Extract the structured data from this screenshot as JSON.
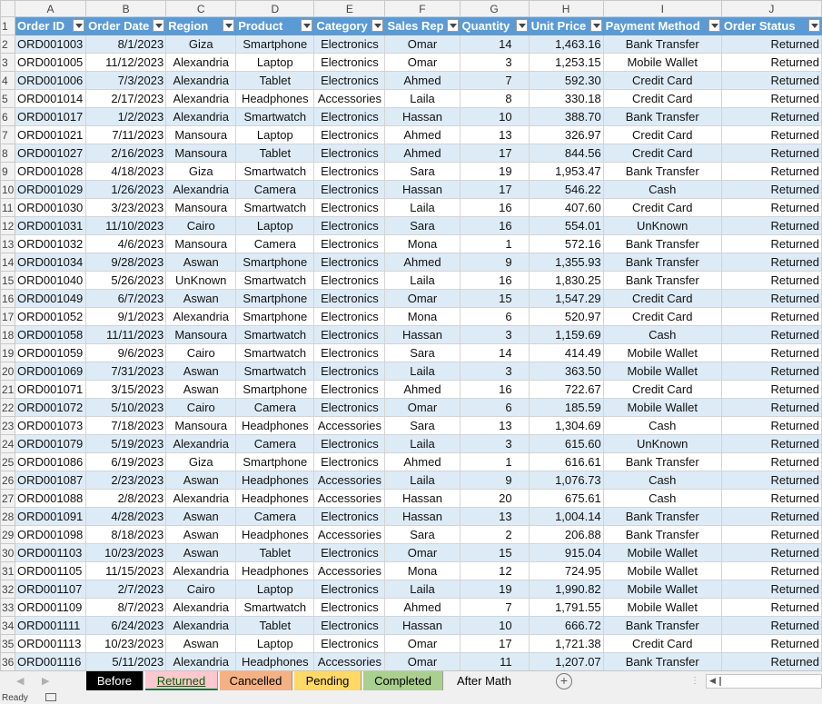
{
  "columns": [
    "A",
    "B",
    "C",
    "D",
    "E",
    "F",
    "G",
    "H",
    "I",
    "J"
  ],
  "headers": [
    "Order ID",
    "Order Date",
    "Region",
    "Product",
    "Category",
    "Sales Rep",
    "Quantity",
    "Unit Price",
    "Payment Method",
    "Order Status"
  ],
  "rows": [
    [
      "ORD001003",
      "8/1/2023",
      "Giza",
      "Smartphone",
      "Electronics",
      "Omar",
      "14",
      "1,463.16",
      "Bank Transfer",
      "Returned"
    ],
    [
      "ORD001005",
      "11/12/2023",
      "Alexandria",
      "Laptop",
      "Electronics",
      "Omar",
      "3",
      "1,253.15",
      "Mobile Wallet",
      "Returned"
    ],
    [
      "ORD001006",
      "7/3/2023",
      "Alexandria",
      "Tablet",
      "Electronics",
      "Ahmed",
      "7",
      "592.30",
      "Credit Card",
      "Returned"
    ],
    [
      "ORD001014",
      "2/17/2023",
      "Alexandria",
      "Headphones",
      "Accessories",
      "Laila",
      "8",
      "330.18",
      "Credit Card",
      "Returned"
    ],
    [
      "ORD001017",
      "1/2/2023",
      "Alexandria",
      "Smartwatch",
      "Electronics",
      "Hassan",
      "10",
      "388.70",
      "Bank Transfer",
      "Returned"
    ],
    [
      "ORD001021",
      "7/11/2023",
      "Mansoura",
      "Laptop",
      "Electronics",
      "Ahmed",
      "13",
      "326.97",
      "Credit Card",
      "Returned"
    ],
    [
      "ORD001027",
      "2/16/2023",
      "Mansoura",
      "Tablet",
      "Electronics",
      "Ahmed",
      "17",
      "844.56",
      "Credit Card",
      "Returned"
    ],
    [
      "ORD001028",
      "4/18/2023",
      "Giza",
      "Smartwatch",
      "Electronics",
      "Sara",
      "19",
      "1,953.47",
      "Bank Transfer",
      "Returned"
    ],
    [
      "ORD001029",
      "1/26/2023",
      "Alexandria",
      "Camera",
      "Electronics",
      "Hassan",
      "17",
      "546.22",
      "Cash",
      "Returned"
    ],
    [
      "ORD001030",
      "3/23/2023",
      "Mansoura",
      "Smartwatch",
      "Electronics",
      "Laila",
      "16",
      "407.60",
      "Credit Card",
      "Returned"
    ],
    [
      "ORD001031",
      "11/10/2023",
      "Cairo",
      "Laptop",
      "Electronics",
      "Sara",
      "16",
      "554.01",
      "UnKnown",
      "Returned"
    ],
    [
      "ORD001032",
      "4/6/2023",
      "Mansoura",
      "Camera",
      "Electronics",
      "Mona",
      "1",
      "572.16",
      "Bank Transfer",
      "Returned"
    ],
    [
      "ORD001034",
      "9/28/2023",
      "Aswan",
      "Smartphone",
      "Electronics",
      "Ahmed",
      "9",
      "1,355.93",
      "Bank Transfer",
      "Returned"
    ],
    [
      "ORD001040",
      "5/26/2023",
      "UnKnown",
      "Smartwatch",
      "Electronics",
      "Laila",
      "16",
      "1,830.25",
      "Bank Transfer",
      "Returned"
    ],
    [
      "ORD001049",
      "6/7/2023",
      "Aswan",
      "Smartphone",
      "Electronics",
      "Omar",
      "15",
      "1,547.29",
      "Credit Card",
      "Returned"
    ],
    [
      "ORD001052",
      "9/1/2023",
      "Alexandria",
      "Smartphone",
      "Electronics",
      "Mona",
      "6",
      "520.97",
      "Credit Card",
      "Returned"
    ],
    [
      "ORD001058",
      "11/11/2023",
      "Mansoura",
      "Smartwatch",
      "Electronics",
      "Hassan",
      "3",
      "1,159.69",
      "Cash",
      "Returned"
    ],
    [
      "ORD001059",
      "9/6/2023",
      "Cairo",
      "Smartwatch",
      "Electronics",
      "Sara",
      "14",
      "414.49",
      "Mobile Wallet",
      "Returned"
    ],
    [
      "ORD001069",
      "7/31/2023",
      "Aswan",
      "Smartwatch",
      "Electronics",
      "Laila",
      "3",
      "363.50",
      "Mobile Wallet",
      "Returned"
    ],
    [
      "ORD001071",
      "3/15/2023",
      "Aswan",
      "Smartphone",
      "Electronics",
      "Ahmed",
      "16",
      "722.67",
      "Credit Card",
      "Returned"
    ],
    [
      "ORD001072",
      "5/10/2023",
      "Cairo",
      "Camera",
      "Electronics",
      "Omar",
      "6",
      "185.59",
      "Mobile Wallet",
      "Returned"
    ],
    [
      "ORD001073",
      "7/18/2023",
      "Mansoura",
      "Headphones",
      "Accessories",
      "Sara",
      "13",
      "1,304.69",
      "Cash",
      "Returned"
    ],
    [
      "ORD001079",
      "5/19/2023",
      "Alexandria",
      "Camera",
      "Electronics",
      "Laila",
      "3",
      "615.60",
      "UnKnown",
      "Returned"
    ],
    [
      "ORD001086",
      "6/19/2023",
      "Giza",
      "Smartphone",
      "Electronics",
      "Ahmed",
      "1",
      "616.61",
      "Bank Transfer",
      "Returned"
    ],
    [
      "ORD001087",
      "2/23/2023",
      "Aswan",
      "Headphones",
      "Accessories",
      "Laila",
      "9",
      "1,076.73",
      "Cash",
      "Returned"
    ],
    [
      "ORD001088",
      "2/8/2023",
      "Alexandria",
      "Headphones",
      "Accessories",
      "Hassan",
      "20",
      "675.61",
      "Cash",
      "Returned"
    ],
    [
      "ORD001091",
      "4/28/2023",
      "Aswan",
      "Camera",
      "Electronics",
      "Hassan",
      "13",
      "1,004.14",
      "Bank Transfer",
      "Returned"
    ],
    [
      "ORD001098",
      "8/18/2023",
      "Aswan",
      "Headphones",
      "Accessories",
      "Sara",
      "2",
      "206.88",
      "Bank Transfer",
      "Returned"
    ],
    [
      "ORD001103",
      "10/23/2023",
      "Aswan",
      "Tablet",
      "Electronics",
      "Omar",
      "15",
      "915.04",
      "Mobile Wallet",
      "Returned"
    ],
    [
      "ORD001105",
      "11/15/2023",
      "Alexandria",
      "Headphones",
      "Accessories",
      "Mona",
      "12",
      "724.95",
      "Mobile Wallet",
      "Returned"
    ],
    [
      "ORD001107",
      "2/7/2023",
      "Cairo",
      "Laptop",
      "Electronics",
      "Laila",
      "19",
      "1,990.82",
      "Mobile Wallet",
      "Returned"
    ],
    [
      "ORD001109",
      "8/7/2023",
      "Alexandria",
      "Smartwatch",
      "Electronics",
      "Ahmed",
      "7",
      "1,791.55",
      "Mobile Wallet",
      "Returned"
    ],
    [
      "ORD001111",
      "6/24/2023",
      "Alexandria",
      "Tablet",
      "Electronics",
      "Hassan",
      "10",
      "666.72",
      "Bank Transfer",
      "Returned"
    ],
    [
      "ORD001113",
      "10/23/2023",
      "Aswan",
      "Laptop",
      "Electronics",
      "Omar",
      "17",
      "1,721.38",
      "Credit Card",
      "Returned"
    ],
    [
      "ORD001116",
      "5/11/2023",
      "Alexandria",
      "Headphones",
      "Accessories",
      "Omar",
      "11",
      "1,207.07",
      "Bank Transfer",
      "Returned"
    ]
  ],
  "sheet_tabs": [
    {
      "label": "Before",
      "bg": "#000000",
      "fg": "#ffffff"
    },
    {
      "label": "Returned",
      "bg": "#ffc7ce",
      "fg": "#006100",
      "active": true
    },
    {
      "label": "Cancelled",
      "bg": "#f4b183",
      "fg": "#000000"
    },
    {
      "label": "Pending",
      "bg": "#ffd966",
      "fg": "#000000"
    },
    {
      "label": "Completed",
      "bg": "#a9d08e",
      "fg": "#000000"
    },
    {
      "label": "After Math",
      "bg": "#f0f0f0",
      "fg": "#000000"
    }
  ],
  "status": {
    "text": "Ready"
  },
  "colors": {
    "header_fill": "#5b9bd5",
    "band_fill": "#ddebf7"
  }
}
